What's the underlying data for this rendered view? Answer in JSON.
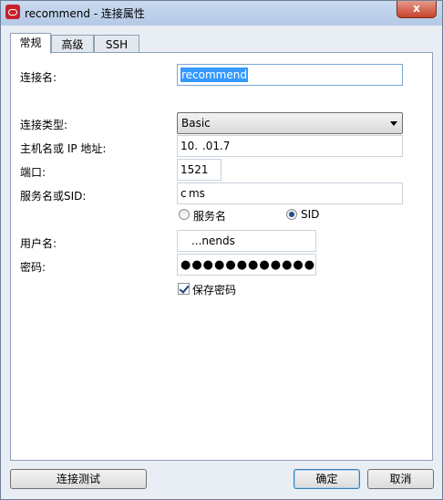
{
  "window": {
    "title": "recommend - 连接属性",
    "close_label": "x"
  },
  "tabs": [
    {
      "label": "常规",
      "active": true
    },
    {
      "label": "高级",
      "active": false
    },
    {
      "label": "SSH",
      "active": false
    }
  ],
  "form": {
    "connection_name_label": "连接名:",
    "connection_name_value": "recommend",
    "connection_type_label": "连接类型:",
    "connection_type_value": "Basic",
    "host_label": "主机名或 IP 地址:",
    "host_value": "10.  .01.7",
    "port_label": "端口:",
    "port_value": "1521",
    "service_label": "服务名或SID:",
    "service_value": "c ms",
    "radio_service_label": "服务名",
    "radio_sid_label": "SID",
    "radio_selected": "SID",
    "username_label": "用户名:",
    "username_value": "     ...nends     ",
    "password_label": "密码:",
    "password_value": "●●●●●●●●●●●●●●",
    "save_password_label": "保存密码",
    "save_password_checked": true
  },
  "buttons": {
    "test": "连接测试",
    "ok": "确定",
    "cancel": "取消"
  }
}
